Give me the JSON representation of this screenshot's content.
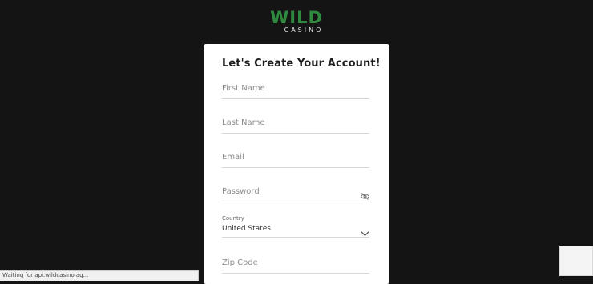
{
  "logo": {
    "brand": "WILD",
    "sub": "CASINO"
  },
  "form": {
    "title": "Let's Create Your Account!",
    "first_name_placeholder": "First Name",
    "last_name_placeholder": "Last Name",
    "email_placeholder": "Email",
    "password_placeholder": "Password",
    "country_label": "Country",
    "country_value": "United States",
    "zip_placeholder": "Zip Code"
  },
  "status_bar": {
    "text": "Waiting for api.wildcasino.ag..."
  },
  "colors": {
    "brand_green": "#2f8a3f",
    "background": "#141414",
    "card": "#ffffff"
  },
  "icons": {
    "password_toggle": "eye-slash-icon",
    "country_dropdown": "chevron-down-icon"
  }
}
